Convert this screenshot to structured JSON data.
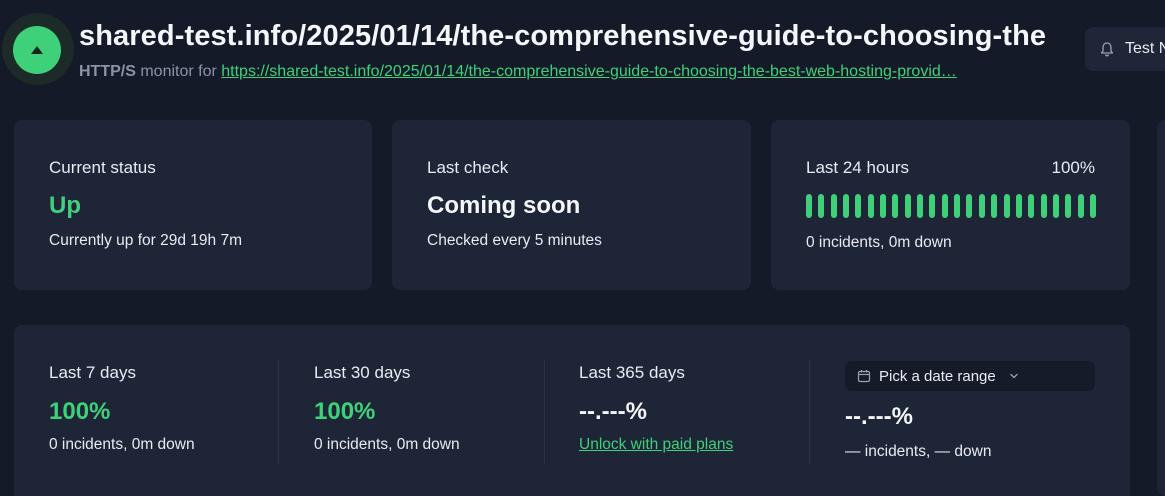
{
  "monitor": {
    "title": "shared-test.info/2025/01/14/the-comprehensive-guide-to-choosing-the",
    "protocol": "HTTP/S",
    "monitor_for": "monitor for",
    "url": "https://shared-test.info/2025/01/14/the-comprehensive-guide-to-choosing-the-best-web-hosting-provid…",
    "status_color": "#3ed179",
    "status_icon": "chevron-up-icon"
  },
  "test_button": {
    "label": "Test N",
    "icon": "bell-icon"
  },
  "current_status": {
    "label": "Current status",
    "value": "Up",
    "detail": "Currently up for 29d 19h 7m"
  },
  "last_check": {
    "label": "Last check",
    "value": "Coming soon",
    "detail": "Checked every 5 minutes"
  },
  "last_24h": {
    "label": "Last 24 hours",
    "percent": "100%",
    "bars": 24,
    "bar_color": "#3ed179",
    "detail": "0 incidents, 0m down"
  },
  "periods": [
    {
      "label": "Last 7 days",
      "value": "100%",
      "detail": "0 incidents, 0m down"
    },
    {
      "label": "Last 30 days",
      "value": "100%",
      "detail": "0 incidents, 0m down"
    },
    {
      "label": "Last 365 days",
      "value": "--.---%",
      "link": "Unlock with paid plans"
    }
  ],
  "date_range": {
    "label": "Pick a date range",
    "icon": "calendar-icon",
    "value": "--.---%",
    "detail": "— incidents, — down"
  },
  "colors": {
    "accent": "#3ed179",
    "background": "#141a27",
    "card": "#1e2536"
  }
}
